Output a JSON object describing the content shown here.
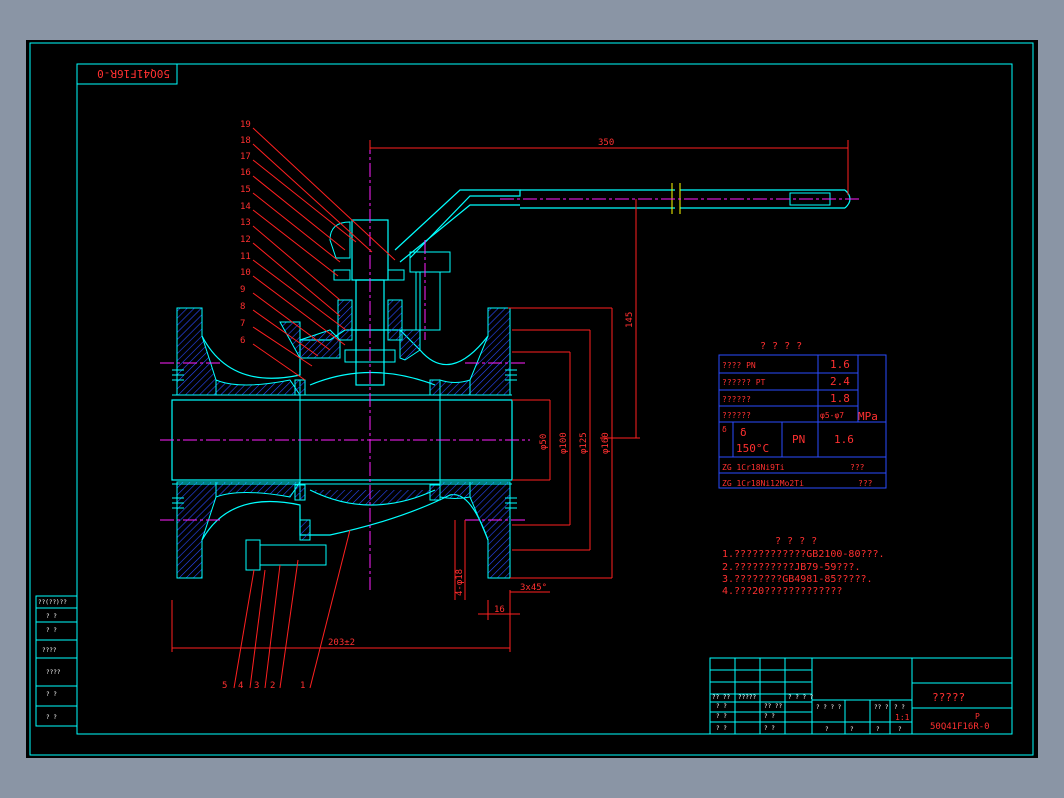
{
  "colors": {
    "frame": "#00ffff",
    "part": "#00ffff",
    "hatch": "#2a4bff",
    "dim": "#ff2020",
    "center": "#ff20ff",
    "text": "#ff3030",
    "table": "#2a4bff",
    "yellow": "#ffff00",
    "white": "#ffffff"
  },
  "corner_label_mirrored": "50Q41F16R-0",
  "part_callouts": [
    "19",
    "18",
    "17",
    "16",
    "15",
    "14",
    "13",
    "12",
    "11",
    "10",
    "9",
    "8",
    "7",
    "6"
  ],
  "bottom_callouts": [
    "5",
    "4",
    "3",
    "2",
    "1"
  ],
  "dimensions": {
    "width_350": "350",
    "height_145": "145",
    "length": "203±2",
    "d50": "φ50",
    "d100": "φ100",
    "d125": "φ125",
    "d160": "φ160",
    "bolt": "4-φ18",
    "flange": "16",
    "chamfer": "3x45°"
  },
  "spec_table": {
    "title": "? ? ? ?",
    "rows": [
      {
        "label": "???? PN",
        "value": "1.6"
      },
      {
        "label": "?????? PT",
        "value": "2.4"
      },
      {
        "label": "??????",
        "value": "1.8"
      },
      {
        "label": "??????",
        "value": "φ5-φ7"
      }
    ],
    "unit": "MPa",
    "temp_symbol": "δ",
    "temp_value": "150°C",
    "pn_label": "PN",
    "pn_value": "1.6",
    "materials": [
      {
        "label": "ZG 1Cr18Ni9Ti",
        "value": "???"
      },
      {
        "label": "ZG 1Cr18Ni12Mo2Ti",
        "value": "???"
      }
    ]
  },
  "notes": {
    "title": "? ? ? ?",
    "lines": [
      "1.????????????GB2100-80???.",
      "2.??????????JB79-59???.",
      "3.????????GB4981-85?????.",
      "4.???20?????????????"
    ]
  },
  "title_block": {
    "name": "?????",
    "code_p": "P",
    "code": "50Q41F16R-0",
    "scale": "1:1",
    "cells": [
      "?? ??",
      "?????",
      "? ? ? ?",
      "?? ??",
      "? ?",
      "? ? ? ?",
      "?? ?",
      "? ?",
      "? ?",
      "? ?",
      "? ?",
      "? ?",
      "?",
      "?",
      "?",
      "?"
    ]
  },
  "left_block": [
    "??(??)??",
    "? ?",
    "? ?",
    "????",
    "????",
    "? ?",
    "? ?"
  ]
}
